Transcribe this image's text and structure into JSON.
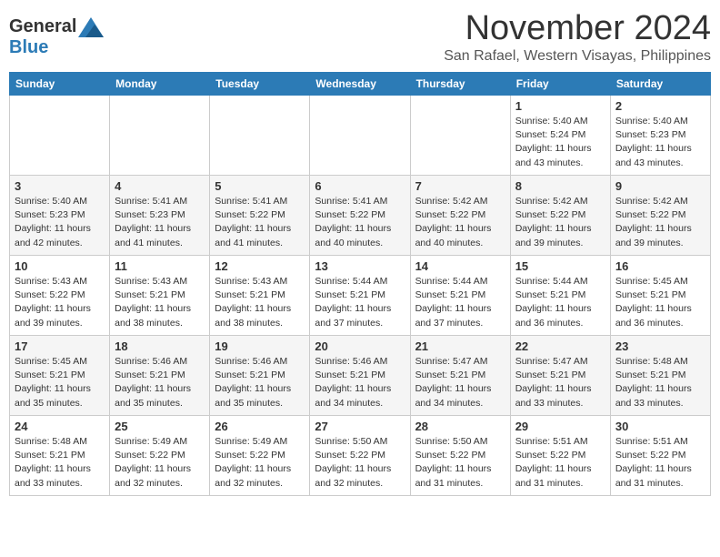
{
  "header": {
    "logo_general": "General",
    "logo_blue": "Blue",
    "month_title": "November 2024",
    "location": "San Rafael, Western Visayas, Philippines"
  },
  "days_of_week": [
    "Sunday",
    "Monday",
    "Tuesday",
    "Wednesday",
    "Thursday",
    "Friday",
    "Saturday"
  ],
  "weeks": [
    [
      {
        "day": "",
        "info": ""
      },
      {
        "day": "",
        "info": ""
      },
      {
        "day": "",
        "info": ""
      },
      {
        "day": "",
        "info": ""
      },
      {
        "day": "",
        "info": ""
      },
      {
        "day": "1",
        "info": "Sunrise: 5:40 AM\nSunset: 5:24 PM\nDaylight: 11 hours\nand 43 minutes."
      },
      {
        "day": "2",
        "info": "Sunrise: 5:40 AM\nSunset: 5:23 PM\nDaylight: 11 hours\nand 43 minutes."
      }
    ],
    [
      {
        "day": "3",
        "info": "Sunrise: 5:40 AM\nSunset: 5:23 PM\nDaylight: 11 hours\nand 42 minutes."
      },
      {
        "day": "4",
        "info": "Sunrise: 5:41 AM\nSunset: 5:23 PM\nDaylight: 11 hours\nand 41 minutes."
      },
      {
        "day": "5",
        "info": "Sunrise: 5:41 AM\nSunset: 5:22 PM\nDaylight: 11 hours\nand 41 minutes."
      },
      {
        "day": "6",
        "info": "Sunrise: 5:41 AM\nSunset: 5:22 PM\nDaylight: 11 hours\nand 40 minutes."
      },
      {
        "day": "7",
        "info": "Sunrise: 5:42 AM\nSunset: 5:22 PM\nDaylight: 11 hours\nand 40 minutes."
      },
      {
        "day": "8",
        "info": "Sunrise: 5:42 AM\nSunset: 5:22 PM\nDaylight: 11 hours\nand 39 minutes."
      },
      {
        "day": "9",
        "info": "Sunrise: 5:42 AM\nSunset: 5:22 PM\nDaylight: 11 hours\nand 39 minutes."
      }
    ],
    [
      {
        "day": "10",
        "info": "Sunrise: 5:43 AM\nSunset: 5:22 PM\nDaylight: 11 hours\nand 39 minutes."
      },
      {
        "day": "11",
        "info": "Sunrise: 5:43 AM\nSunset: 5:21 PM\nDaylight: 11 hours\nand 38 minutes."
      },
      {
        "day": "12",
        "info": "Sunrise: 5:43 AM\nSunset: 5:21 PM\nDaylight: 11 hours\nand 38 minutes."
      },
      {
        "day": "13",
        "info": "Sunrise: 5:44 AM\nSunset: 5:21 PM\nDaylight: 11 hours\nand 37 minutes."
      },
      {
        "day": "14",
        "info": "Sunrise: 5:44 AM\nSunset: 5:21 PM\nDaylight: 11 hours\nand 37 minutes."
      },
      {
        "day": "15",
        "info": "Sunrise: 5:44 AM\nSunset: 5:21 PM\nDaylight: 11 hours\nand 36 minutes."
      },
      {
        "day": "16",
        "info": "Sunrise: 5:45 AM\nSunset: 5:21 PM\nDaylight: 11 hours\nand 36 minutes."
      }
    ],
    [
      {
        "day": "17",
        "info": "Sunrise: 5:45 AM\nSunset: 5:21 PM\nDaylight: 11 hours\nand 35 minutes."
      },
      {
        "day": "18",
        "info": "Sunrise: 5:46 AM\nSunset: 5:21 PM\nDaylight: 11 hours\nand 35 minutes."
      },
      {
        "day": "19",
        "info": "Sunrise: 5:46 AM\nSunset: 5:21 PM\nDaylight: 11 hours\nand 35 minutes."
      },
      {
        "day": "20",
        "info": "Sunrise: 5:46 AM\nSunset: 5:21 PM\nDaylight: 11 hours\nand 34 minutes."
      },
      {
        "day": "21",
        "info": "Sunrise: 5:47 AM\nSunset: 5:21 PM\nDaylight: 11 hours\nand 34 minutes."
      },
      {
        "day": "22",
        "info": "Sunrise: 5:47 AM\nSunset: 5:21 PM\nDaylight: 11 hours\nand 33 minutes."
      },
      {
        "day": "23",
        "info": "Sunrise: 5:48 AM\nSunset: 5:21 PM\nDaylight: 11 hours\nand 33 minutes."
      }
    ],
    [
      {
        "day": "24",
        "info": "Sunrise: 5:48 AM\nSunset: 5:21 PM\nDaylight: 11 hours\nand 33 minutes."
      },
      {
        "day": "25",
        "info": "Sunrise: 5:49 AM\nSunset: 5:22 PM\nDaylight: 11 hours\nand 32 minutes."
      },
      {
        "day": "26",
        "info": "Sunrise: 5:49 AM\nSunset: 5:22 PM\nDaylight: 11 hours\nand 32 minutes."
      },
      {
        "day": "27",
        "info": "Sunrise: 5:50 AM\nSunset: 5:22 PM\nDaylight: 11 hours\nand 32 minutes."
      },
      {
        "day": "28",
        "info": "Sunrise: 5:50 AM\nSunset: 5:22 PM\nDaylight: 11 hours\nand 31 minutes."
      },
      {
        "day": "29",
        "info": "Sunrise: 5:51 AM\nSunset: 5:22 PM\nDaylight: 11 hours\nand 31 minutes."
      },
      {
        "day": "30",
        "info": "Sunrise: 5:51 AM\nSunset: 5:22 PM\nDaylight: 11 hours\nand 31 minutes."
      }
    ]
  ]
}
